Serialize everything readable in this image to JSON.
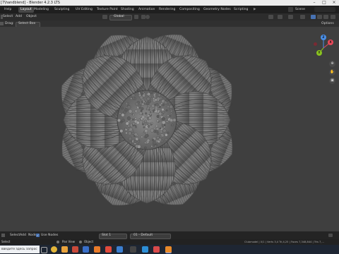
{
  "window": {
    "title": "[7\\handblend] - Blender 4.2.3 LTS"
  },
  "workspaces": [
    "Help",
    "Layout",
    "Modeling",
    "Sculpting",
    "UV Editing",
    "Texture Paint",
    "Shading",
    "Animation",
    "Rendering",
    "Compositing",
    "Geometry Nodes",
    "Scripting"
  ],
  "active_workspace": "Layout",
  "scene": {
    "label": "Scene"
  },
  "header": {
    "select": "Select",
    "add": "Add",
    "object": "Object",
    "orientation": "Global"
  },
  "toolrow": {
    "drag_label": "Drag:",
    "drag_value": "Select Box",
    "options": "Options"
  },
  "gizmo": {
    "x": "X",
    "y": "Y",
    "z": "Z"
  },
  "timeline": {
    "menus": [
      "Select",
      "Add",
      "Node"
    ],
    "use_nodes_label": "Use Nodes",
    "slot_label": "Slot 1",
    "material_label": "01 - Default"
  },
  "status": {
    "pan_view": "Pan View",
    "object": "Object",
    "right_text": "Clubmodel | 0/1 | Verts 3,4 Tri,4,25 | Faces 7,348,844 | Tris 7,...",
    "left_text": "Select"
  },
  "taskbar": {
    "search_placeholder": "введите здесь запрос"
  },
  "colors": {
    "accent": "#4772b3",
    "viewport": "#3f3f3f",
    "gizmo_x": "#e8495a",
    "gizmo_y": "#8ac31f",
    "gizmo_z": "#4a8fe8"
  }
}
